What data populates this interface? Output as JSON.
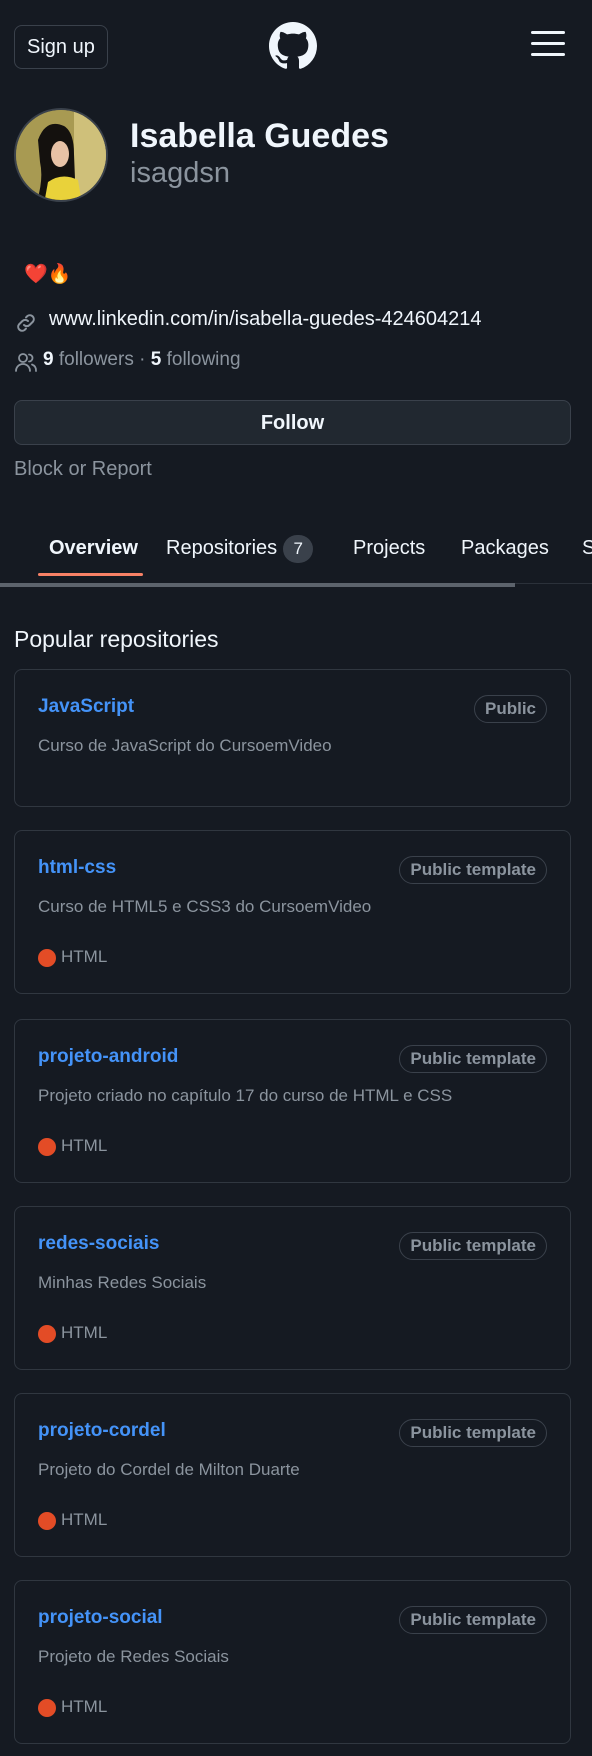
{
  "header": {
    "signup_label": "Sign up",
    "logo_icon": "github-octocat-icon",
    "menu_icon": "hamburger-menu-icon"
  },
  "profile": {
    "display_name": "Isabella Guedes",
    "username": "isagdsn",
    "bio_emojis": [
      "❤️",
      "🔥"
    ],
    "link": "www.linkedin.com/in/isabella-guedes-424604214",
    "followers_count": "9",
    "followers_label": "followers",
    "separator": "·",
    "following_count": "5",
    "following_label": "following",
    "follow_button": "Follow",
    "block_report": "Block or Report"
  },
  "tabs": [
    {
      "label": "Overview",
      "active": true
    },
    {
      "label": "Repositories",
      "count": "7"
    },
    {
      "label": "Projects"
    },
    {
      "label": "Packages"
    },
    {
      "label": "S"
    }
  ],
  "section": {
    "title": "Popular repositories"
  },
  "repos": [
    {
      "name": "JavaScript",
      "visibility": "Public",
      "description": "Curso de JavaScript do CursoemVideo"
    },
    {
      "name": "html-css",
      "visibility": "Public template",
      "description": "Curso de HTML5 e CSS3 do CursoemVideo",
      "language": "HTML"
    },
    {
      "name": "projeto-android",
      "visibility": "Public template",
      "description": "Projeto criado no capítulo 17 do curso de HTML e CSS",
      "language": "HTML"
    },
    {
      "name": "redes-sociais",
      "visibility": "Public template",
      "description": "Minhas Redes Sociais",
      "language": "HTML"
    },
    {
      "name": "projeto-cordel",
      "visibility": "Public template",
      "description": "Projeto do Cordel de Milton Duarte",
      "language": "HTML"
    },
    {
      "name": "projeto-social",
      "visibility": "Public template",
      "description": "Projeto de Redes Sociais",
      "language": "HTML"
    }
  ],
  "colors": {
    "background": "#151a22",
    "link_blue": "#4493f8",
    "tab_underline": "#f78166",
    "html_language": "#e34c26",
    "muted_text": "#8b949e"
  }
}
